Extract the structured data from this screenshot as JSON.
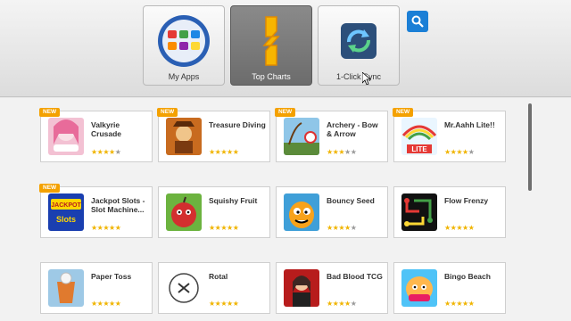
{
  "tabs": [
    {
      "label": "My Apps",
      "icon": "grid-apps-icon",
      "active": false
    },
    {
      "label": "Top Charts",
      "icon": "top-charts-icon",
      "active": true
    },
    {
      "label": "1-Click Sync",
      "icon": "sync-icon",
      "active": false
    }
  ],
  "search": {
    "icon": "search-icon"
  },
  "badge_text": "NEW",
  "apps": [
    {
      "name": "Valkyrie Crusade",
      "new": true,
      "rating": 4
    },
    {
      "name": "Treasure Diving",
      "new": true,
      "rating": 4.5
    },
    {
      "name": "Archery - Bow & Arrow",
      "new": true,
      "rating": 3.5
    },
    {
      "name": "Mr.Aahh Lite!!",
      "new": true,
      "rating": 4
    },
    {
      "name": "Jackpot Slots - Slot Machine...",
      "new": true,
      "rating": 4.5
    },
    {
      "name": "Squishy Fruit",
      "new": false,
      "rating": 4.5
    },
    {
      "name": "Bouncy Seed",
      "new": false,
      "rating": 4
    },
    {
      "name": "Flow Frenzy",
      "new": false,
      "rating": 4.5
    },
    {
      "name": "Paper Toss",
      "new": false,
      "rating": 4.5
    },
    {
      "name": "Rotal",
      "new": false,
      "rating": 4.5
    },
    {
      "name": "Bad Blood TCG",
      "new": false,
      "rating": 4
    },
    {
      "name": "Bingo Beach",
      "new": false,
      "rating": 4.5
    }
  ],
  "colors": {
    "accent": "#1b7fd6",
    "badge": "#f4a100",
    "star": "#f0b400"
  }
}
